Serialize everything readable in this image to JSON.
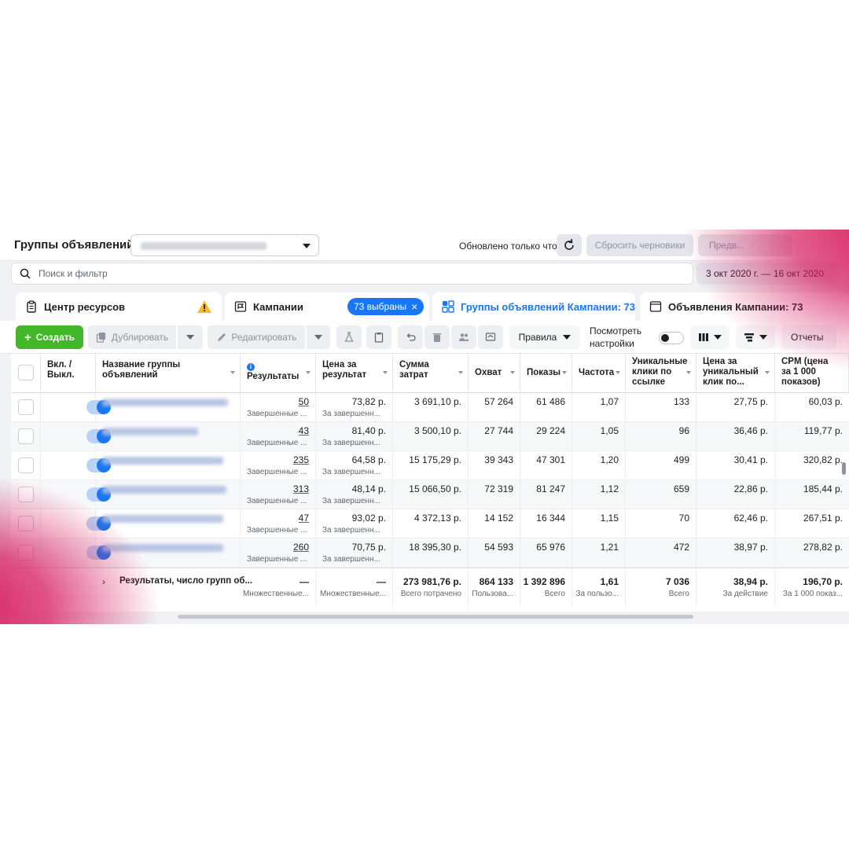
{
  "header": {
    "title": "Группы объявлений",
    "updated_text": "Обновлено только что",
    "reset_drafts": "Сбросить черновики",
    "preview": "Предв..."
  },
  "search": {
    "placeholder": "Поиск и фильтр"
  },
  "date_range": "3 окт 2020 г. — 16 окт 2020",
  "tabs": [
    {
      "label": "Центр ресурсов"
    },
    {
      "label": "Кампании",
      "chip": "73 выбраны"
    },
    {
      "label": "Группы объявлений Кампании: 73",
      "active": true
    },
    {
      "label": "Объявления Кампании: 73"
    }
  ],
  "toolbar": {
    "create": "Создать",
    "duplicate": "Дублировать",
    "edit": "Редактировать",
    "rules": "Правила",
    "view_settings": "Посмотреть настройки",
    "reports": "Отчеты"
  },
  "columns": [
    "Вкл. / Выкл.",
    "Название группы объявлений",
    "Результаты",
    "Цена за результат",
    "Сумма затрат",
    "Охват",
    "Показы",
    "Частота",
    "Уникальные клики по ссылке",
    "Цена за уникальный клик по...",
    "CPM (цена за 1 000 показов)"
  ],
  "rows": [
    {
      "results": "50",
      "results_sub": "Завершенные ...",
      "cpr": "73,82 р.",
      "cpr_sub": "За завершенн...",
      "spend": "3 691,10 р.",
      "reach": "57 264",
      "impr": "61 486",
      "freq": "1,07",
      "clicks": "133",
      "cpc": "27,75 р.",
      "cpm": "60,03 р."
    },
    {
      "results": "43",
      "results_sub": "Завершенные ...",
      "cpr": "81,40 р.",
      "cpr_sub": "За завершенн...",
      "spend": "3 500,10 р.",
      "reach": "27 744",
      "impr": "29 224",
      "freq": "1,05",
      "clicks": "96",
      "cpc": "36,46 р.",
      "cpm": "119,77 р."
    },
    {
      "results": "235",
      "results_sub": "Завершенные ...",
      "cpr": "64,58 р.",
      "cpr_sub": "За завершенн...",
      "spend": "15 175,29 р.",
      "reach": "39 343",
      "impr": "47 301",
      "freq": "1,20",
      "clicks": "499",
      "cpc": "30,41 р.",
      "cpm": "320,82 р."
    },
    {
      "results": "313",
      "results_sub": "Завершенные ...",
      "cpr": "48,14 р.",
      "cpr_sub": "За завершенн...",
      "spend": "15 066,50 р.",
      "reach": "72 319",
      "impr": "81 247",
      "freq": "1,12",
      "clicks": "659",
      "cpc": "22,86 р.",
      "cpm": "185,44 р."
    },
    {
      "results": "47",
      "results_sub": "Завершенные ...",
      "cpr": "93,02 р.",
      "cpr_sub": "За завершенн...",
      "spend": "4 372,13 р.",
      "reach": "14 152",
      "impr": "16 344",
      "freq": "1,15",
      "clicks": "70",
      "cpc": "62,46 р.",
      "cpm": "267,51 р."
    },
    {
      "results": "260",
      "results_sub": "Завершенные ...",
      "cpr": "70,75 р.",
      "cpr_sub": "За завершенн...",
      "spend": "18 395,30 р.",
      "reach": "54 593",
      "impr": "65 976",
      "freq": "1,21",
      "clicks": "472",
      "cpc": "38,97 р.",
      "cpm": "278,82 р."
    }
  ],
  "totals": {
    "label": "Результаты, число групп об...",
    "results": "—",
    "results_sub": "Множественные...",
    "cpr": "—",
    "cpr_sub": "Множественные...",
    "spend": "273 981,76 р.",
    "spend_sub": "Всего потрачено",
    "reach": "864 133",
    "reach_sub": "Пользова...",
    "impr": "1 392 896",
    "impr_sub": "Всего",
    "freq": "1,61",
    "freq_sub": "За пользо...",
    "clicks": "7 036",
    "clicks_sub": "Всего",
    "cpc": "38,94 р.",
    "cpc_sub": "За действие",
    "cpm": "196,70 р.",
    "cpm_sub": "За 1 000 показ..."
  },
  "icons": {
    "search": "search-icon",
    "refresh": "refresh-icon",
    "warning": "warning-icon",
    "clipboard": "clipboard-icon",
    "flag": "flag-icon",
    "grid": "grid-icon",
    "ad": "ad-icon"
  },
  "colors": {
    "accent": "#1877f2",
    "create": "#42b72a",
    "warning": "#f7b928",
    "splash": "#d61a5c"
  }
}
